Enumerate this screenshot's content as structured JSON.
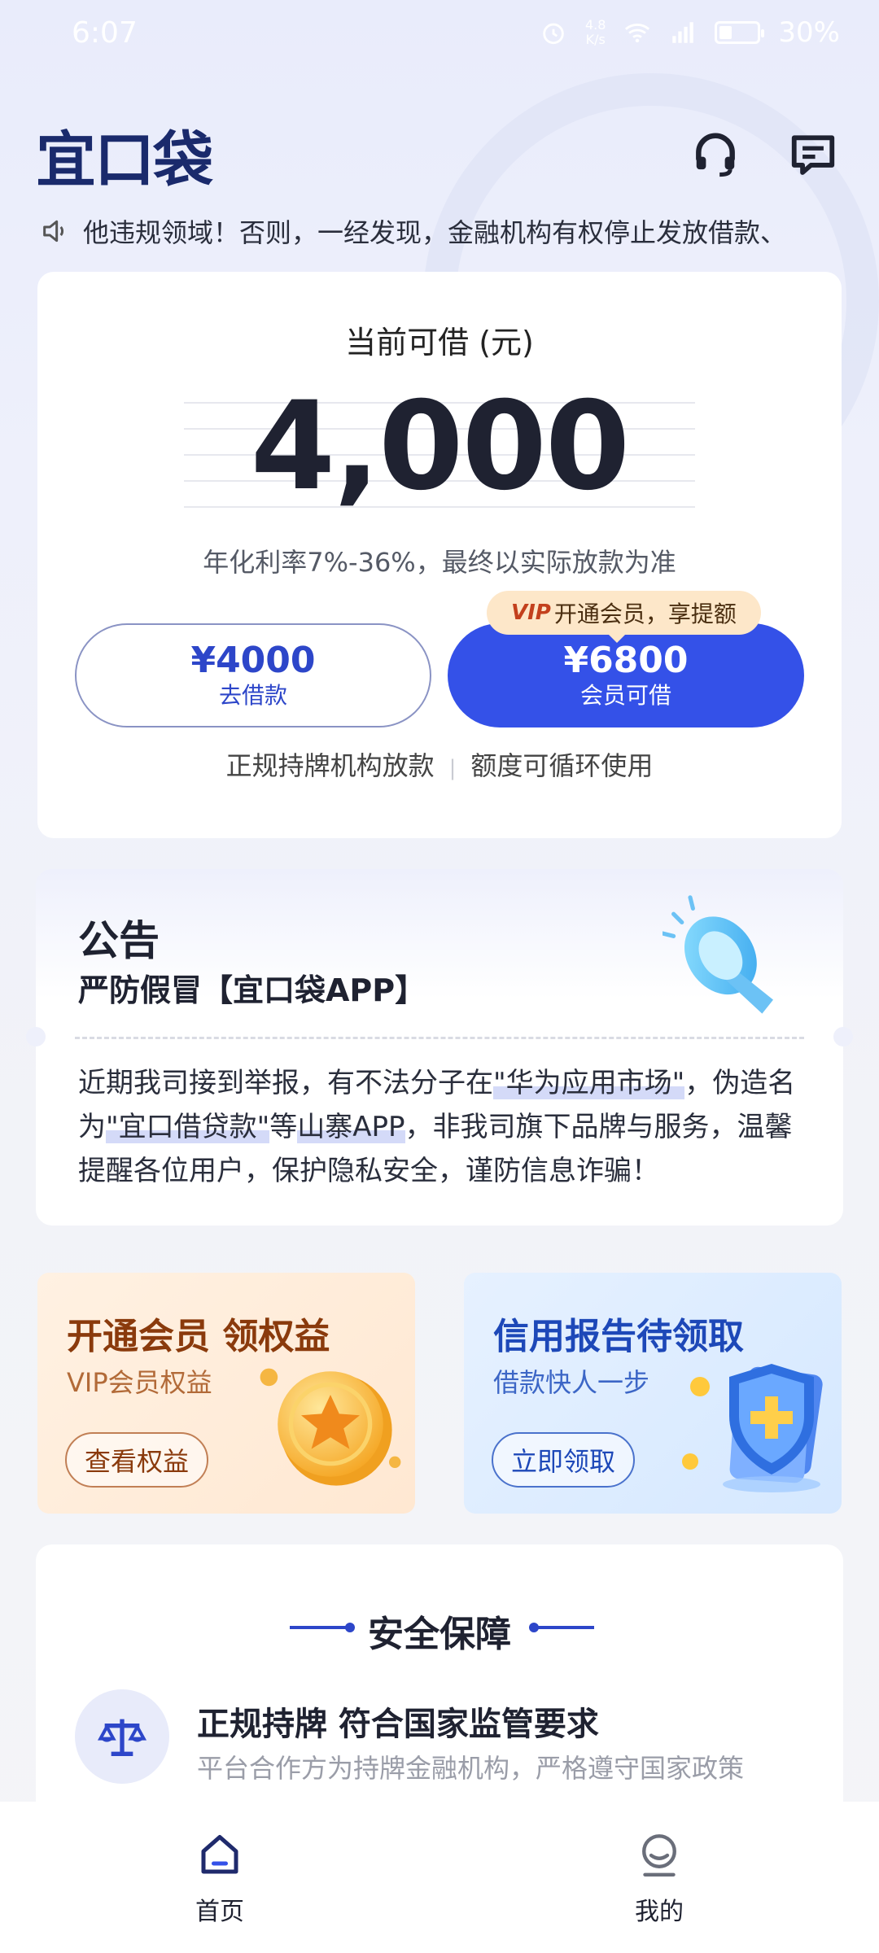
{
  "status_bar": {
    "time": "6:07",
    "net_speed_value": "4.8",
    "net_speed_unit": "K/s",
    "battery": "30%"
  },
  "header": {
    "logo": "宜口袋",
    "icons": [
      "headset-icon",
      "message-icon"
    ]
  },
  "marquee": {
    "text": "他违规领域！否则，一经发现，金融机构有权停止发放借款、"
  },
  "main_card": {
    "title": "当前可借 (元)",
    "amount": "4,000",
    "rate_text": "年化利率7%-36%，最终以实际放款为准",
    "borrow_button": {
      "amount": "¥4000",
      "label": "去借款"
    },
    "member_button": {
      "amount": "¥6800",
      "label": "会员可借"
    },
    "vip_tag": {
      "logo": "VIP",
      "text": "开通会员，享提额"
    },
    "features": [
      "正规持牌机构放款",
      "额度可循环使用"
    ]
  },
  "announcement": {
    "title": "公告",
    "subtitle": "严防假冒【宜口袋APP】",
    "body_parts": {
      "p1": "近期我司接到举报，有不法分子在",
      "h1": "\"华为应用市场\"",
      "p2": "，伪造名为",
      "h2": "\"宜口借贷款\"",
      "p3": "等",
      "h3": "山寨APP",
      "p4": "，非我司旗下品牌与服务，温馨提醒各位用户，保护隐私安全，谨防信息诈骗！"
    }
  },
  "promos": [
    {
      "title": "开通会员 领权益",
      "subtitle": "VIP会员权益",
      "button": "查看权益"
    },
    {
      "title": "信用报告待领取",
      "subtitle": "借款快人一步",
      "button": "立即领取"
    }
  ],
  "security": {
    "title": "安全保障",
    "item_title": "正规持牌 符合国家监管要求",
    "item_desc": "平台合作方为持牌金融机构，严格遵守国家政策"
  },
  "tabbar": {
    "tabs": [
      {
        "label": "首页"
      },
      {
        "label": "我的"
      }
    ]
  },
  "colors": {
    "primary": "#3451e8",
    "logo": "#1a2a6c",
    "vip_tag_bg": "#fde7c9"
  }
}
